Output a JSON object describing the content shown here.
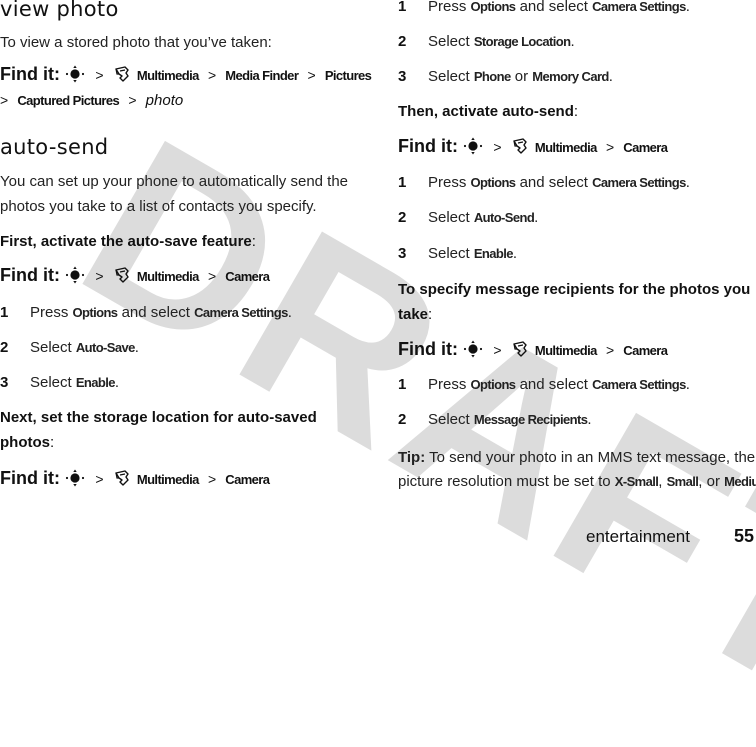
{
  "watermark": "DRAFT",
  "left": {
    "view_photo": {
      "heading": "view photo",
      "intro": "To view a stored photo that you’ve taken:",
      "find_it": {
        "label": "Find it:",
        "path": [
          "Multimedia",
          "Media Finder",
          "Pictures",
          "Captured Pictures"
        ],
        "end_italic": "photo"
      }
    },
    "auto_send": {
      "heading": "auto-send",
      "intro_line1": "You can set up your phone to automatically send the",
      "intro_line2": "photos you take to a list of contacts you specify.",
      "first_lead": "First, activate the auto-save feature",
      "find_it": {
        "label": "Find it:",
        "path": [
          "Multimedia",
          "Camera"
        ]
      },
      "steps": [
        {
          "num": "1",
          "pre": "Press ",
          "b1": "Options",
          "mid": " and select ",
          "b2": "Camera Settings",
          "post": "."
        },
        {
          "num": "2",
          "pre": "Select ",
          "b1": "Auto-Save",
          "post": "."
        },
        {
          "num": "3",
          "pre": "Select ",
          "b1": "Enable",
          "post": "."
        }
      ],
      "next_lead_line1": "Next, set the storage location for auto-saved",
      "next_lead_line2": "photos",
      "find_it2": {
        "label": "Find it:",
        "path": [
          "Multimedia",
          "Camera"
        ]
      }
    }
  },
  "right": {
    "steps_a": [
      {
        "num": "1",
        "pre": "Press ",
        "b1": "Options",
        "mid": " and select ",
        "b2": "Camera Settings",
        "post": "."
      },
      {
        "num": "2",
        "pre": "Select ",
        "b1": "Storage Location",
        "post": "."
      },
      {
        "num": "3",
        "pre": "Select ",
        "b1": "Phone",
        "mid": " or ",
        "b2": "Memory Card",
        "post": "."
      }
    ],
    "then_lead": "Then, activate auto-send",
    "find_it": {
      "label": "Find it:",
      "path": [
        "Multimedia",
        "Camera"
      ]
    },
    "steps_b": [
      {
        "num": "1",
        "pre": "Press ",
        "b1": "Options",
        "mid": " and select ",
        "b2": "Camera Settings",
        "post": "."
      },
      {
        "num": "2",
        "pre": "Select ",
        "b1": "Auto-Send",
        "post": "."
      },
      {
        "num": "3",
        "pre": "Select ",
        "b1": "Enable",
        "post": "."
      }
    ],
    "recip_lead_line1": "To specify message recipients for the photos you",
    "recip_lead_line2": "take",
    "find_it2": {
      "label": "Find it:",
      "path": [
        "Multimedia",
        "Camera"
      ]
    },
    "steps_c": [
      {
        "num": "1",
        "pre": "Press ",
        "b1": "Options",
        "mid": " and select ",
        "b2": "Camera Settings",
        "post": "."
      },
      {
        "num": "2",
        "pre": "Select ",
        "b1": "Message Recipients",
        "post": "."
      }
    ],
    "tip": {
      "label": "Tip:",
      "line1": " To send your photo in an MMS text message, the",
      "line2_pre": "picture resolution must be set to ",
      "opt1": "X-Small",
      "sep1": ", ",
      "opt2": "Small",
      "sep2": ", or ",
      "opt3": "Medium",
      "end": "."
    }
  },
  "footer": {
    "section": "entertainment",
    "page": "55"
  },
  "symbols": {
    "gt": ">",
    "colon": ":"
  }
}
